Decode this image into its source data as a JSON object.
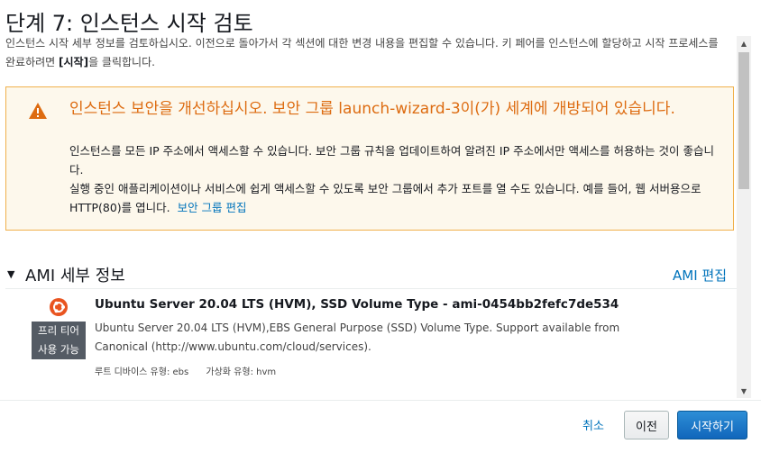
{
  "header": {
    "title": "단계 7: 인스턴스 시작 검토",
    "description_1": "인스턴스 시작 세부 정보를 검토하십시오. 이전으로 돌아가서 각 섹션에 대한 변경 내용을 편집할 수 있습니다. 키 페어를 인스턴스에 할당하고 시작 프로세스를 완료하려면 ",
    "description_bold": "[시작]",
    "description_2": "을 클릭합니다."
  },
  "warning": {
    "icon": "warning-triangle-icon",
    "title": "인스턴스 보안을 개선하십시오. 보안 그룹 launch-wizard-3이(가) 세계에 개방되어 있습니다.",
    "body_1": "인스턴스를 모든 IP 주소에서 액세스할 수 있습니다. 보안 그룹 규칙을 업데이트하여 알려진 IP 주소에서만 액세스를 허용하는 것이 좋습니다.",
    "body_2": "실행 중인 애플리케이션이나 서비스에 쉽게 액세스할 수 있도록 보안 그룹에서 추가 포트를 열 수도 있습니다. 예를 들어, 웹 서버용으로 HTTP(80)를 엽니다.",
    "link": "보안 그룹 편집",
    "color": "#dd6b10"
  },
  "ami_section": {
    "title": "AMI 세부 정보",
    "edit_link": "AMI 편집",
    "badge_line1": "프리 티어",
    "badge_line2": "사용 가능",
    "name": "Ubuntu Server 20.04 LTS (HVM), SSD Volume Type - ami-0454bb2fefc7de534",
    "description": "Ubuntu Server 20.04 LTS (HVM),EBS General Purpose (SSD) Volume Type. Support available from Canonical (http://www.ubuntu.com/cloud/services).",
    "root_device": "루트 디바이스 유형: ebs",
    "virtualization": "가상화 유형: hvm",
    "icon": "ubuntu-logo-icon"
  },
  "footer": {
    "cancel": "취소",
    "previous": "이전",
    "launch": "시작하기",
    "primary_color": "#1166bb"
  }
}
